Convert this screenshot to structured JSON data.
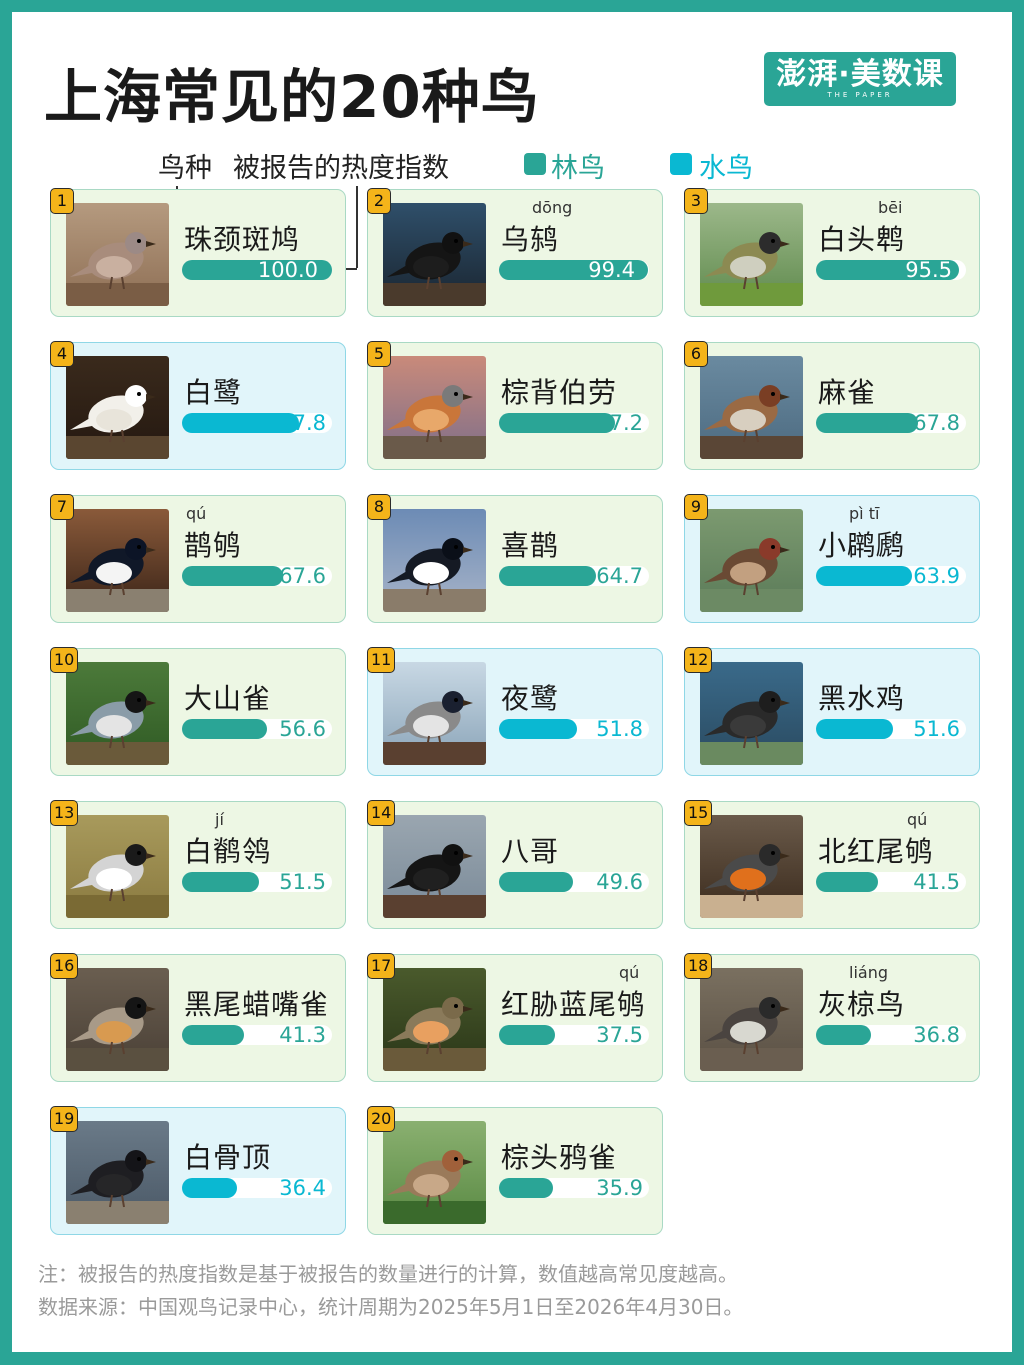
{
  "title": "上海常见的20种鸟",
  "brand": {
    "name": "澎湃·美数课",
    "sub": "THE PAPER"
  },
  "legend": {
    "species": "鸟种",
    "index": "被报告的热度指数",
    "forest": "林鸟",
    "water": "水鸟"
  },
  "colors": {
    "forest": "#2aa596",
    "water": "#0ab8d2",
    "accent": "#f4b41a"
  },
  "chart_data": {
    "type": "bar",
    "title": "上海常见的20种鸟",
    "ylabel": "被报告的热度指数",
    "ylim": [
      0,
      100
    ],
    "categories": [
      "珠颈斑鸠",
      "乌鸫",
      "白头鹎",
      "白鹭",
      "棕背伯劳",
      "麻雀",
      "鹊鸲",
      "喜鹊",
      "小䴙䴘",
      "大山雀",
      "夜鹭",
      "黑水鸡",
      "白鹡鸰",
      "八哥",
      "北红尾鸲",
      "黑尾蜡嘴雀",
      "红胁蓝尾鸲",
      "灰椋鸟",
      "白骨顶",
      "棕头鸦雀"
    ],
    "series": [
      {
        "values": [
          100.0,
          99.4,
          95.5,
          77.8,
          77.2,
          67.8,
          67.6,
          64.7,
          63.9,
          56.6,
          51.8,
          51.6,
          51.5,
          49.6,
          41.5,
          41.3,
          37.5,
          36.8,
          36.4,
          35.9
        ]
      }
    ],
    "birds": [
      {
        "rank": "1",
        "name": "珠颈斑鸠",
        "pinyin": "",
        "value": 100.0,
        "value_label": "100.0",
        "group": "forest",
        "icon": "spotted-dove-photo"
      },
      {
        "rank": "2",
        "name": "乌鸫",
        "pinyin": "dōng",
        "value": 99.4,
        "value_label": "99.4",
        "group": "forest",
        "icon": "blackbird-photo"
      },
      {
        "rank": "3",
        "name": "白头鹎",
        "pinyin": "bēi",
        "value": 95.5,
        "value_label": "95.5",
        "group": "forest",
        "icon": "bulbul-photo"
      },
      {
        "rank": "4",
        "name": "白鹭",
        "pinyin": "",
        "value": 77.8,
        "value_label": "77.8",
        "group": "water",
        "icon": "egret-photo"
      },
      {
        "rank": "5",
        "name": "棕背伯劳",
        "pinyin": "",
        "value": 77.2,
        "value_label": "7.2",
        "group": "forest",
        "icon": "shrike-photo"
      },
      {
        "rank": "6",
        "name": "麻雀",
        "pinyin": "",
        "value": 67.8,
        "value_label": "67.8",
        "group": "forest",
        "icon": "sparrow-photo"
      },
      {
        "rank": "7",
        "name": "鹊鸲",
        "pinyin": "qú",
        "value": 67.6,
        "value_label": "67.6",
        "group": "forest",
        "icon": "magpie-robin-photo"
      },
      {
        "rank": "8",
        "name": "喜鹊",
        "pinyin": "",
        "value": 64.7,
        "value_label": "64.7",
        "group": "forest",
        "icon": "magpie-photo"
      },
      {
        "rank": "9",
        "name": "小䴙䴘",
        "pinyin": "pì   tī",
        "value": 63.9,
        "value_label": "63.9",
        "group": "water",
        "icon": "grebe-photo"
      },
      {
        "rank": "10",
        "name": "大山雀",
        "pinyin": "",
        "value": 56.6,
        "value_label": "56.6",
        "group": "forest",
        "icon": "great-tit-photo"
      },
      {
        "rank": "11",
        "name": "夜鹭",
        "pinyin": "",
        "value": 51.8,
        "value_label": "51.8",
        "group": "water",
        "icon": "night-heron-photo"
      },
      {
        "rank": "12",
        "name": "黑水鸡",
        "pinyin": "",
        "value": 51.6,
        "value_label": "51.6",
        "group": "water",
        "icon": "moorhen-photo"
      },
      {
        "rank": "13",
        "name": "白鹡鸰",
        "pinyin": "jí",
        "value": 51.5,
        "value_label": "51.5",
        "group": "forest",
        "icon": "wagtail-photo"
      },
      {
        "rank": "14",
        "name": "八哥",
        "pinyin": "",
        "value": 49.6,
        "value_label": "49.6",
        "group": "forest",
        "icon": "myna-photo"
      },
      {
        "rank": "15",
        "name": "北红尾鸲",
        "pinyin": "qú",
        "value": 41.5,
        "value_label": "41.5",
        "group": "forest",
        "icon": "redstart-photo"
      },
      {
        "rank": "16",
        "name": "黑尾蜡嘴雀",
        "pinyin": "",
        "value": 41.3,
        "value_label": "41.3",
        "group": "forest",
        "icon": "grosbeak-photo"
      },
      {
        "rank": "17",
        "name": "红胁蓝尾鸲",
        "pinyin": "qú",
        "value": 37.5,
        "value_label": "37.5",
        "group": "forest",
        "icon": "bluetail-photo"
      },
      {
        "rank": "18",
        "name": "灰椋鸟",
        "pinyin": "liáng",
        "value": 36.8,
        "value_label": "36.8",
        "group": "forest",
        "icon": "starling-photo"
      },
      {
        "rank": "19",
        "name": "白骨顶",
        "pinyin": "",
        "value": 36.4,
        "value_label": "36.4",
        "group": "water",
        "icon": "coot-photo"
      },
      {
        "rank": "20",
        "name": "棕头鸦雀",
        "pinyin": "",
        "value": 35.9,
        "value_label": "35.9",
        "group": "forest",
        "icon": "parrotbill-photo"
      }
    ]
  },
  "notes": {
    "line1": "注：被报告的热度指数是基于被报告的数量进行的计算，数值越高常见度越高。",
    "line2": "数据来源：中国观鸟记录中心，统计周期为2025年5月1日至2026年4月30日。"
  }
}
